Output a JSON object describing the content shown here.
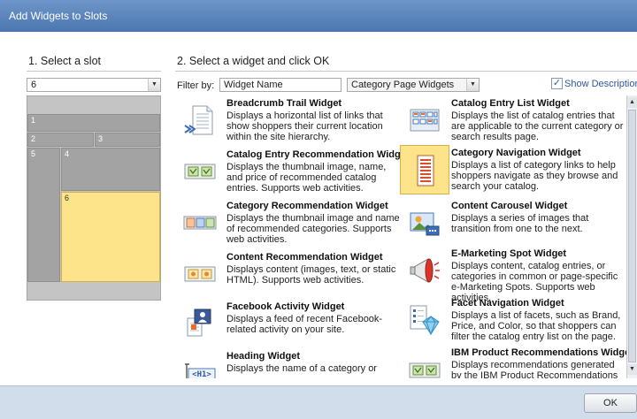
{
  "dialog": {
    "title": "Add Widgets to Slots"
  },
  "slots": {
    "heading": "1. Select a slot",
    "selected": "6",
    "map": [
      "1",
      "2",
      "3",
      "5",
      "4",
      "6"
    ]
  },
  "widget_panel": {
    "heading": "2. Select a widget and click OK",
    "filter_label": "Filter by:",
    "filter_value": "Widget Name",
    "category_value": "Category Page Widgets",
    "show_description_label": "Show Description",
    "show_description_checked": true
  },
  "widgets": [
    {
      "title": "Breadcrumb Trail Widget",
      "desc": "Displays a horizontal list of links that show shoppers their current location within the site hierarchy.",
      "icon": "breadcrumb-icon"
    },
    {
      "title": "Catalog Entry List Widget",
      "desc": "Displays the list of catalog entries that are applicable to the current category or search results page.",
      "icon": "catalog-entry-list-icon"
    },
    {
      "title": "Catalog Entry Recommendation Widget",
      "desc": "Displays the thumbnail image, name, and price of recommended catalog entries. Supports web activities.",
      "icon": "catalog-entry-recommendation-icon"
    },
    {
      "title": "Category Navigation Widget",
      "desc": "Displays a list of category links to help shoppers navigate as they browse and search your catalog.",
      "icon": "category-navigation-icon"
    },
    {
      "title": "Category Recommendation Widget",
      "desc": "Displays the thumbnail image and name of recommended categories. Supports web activities.",
      "icon": "category-recommendation-icon"
    },
    {
      "title": "Content Carousel Widget",
      "desc": "Displays a series of images that transition from one to the next.",
      "icon": "content-carousel-icon"
    },
    {
      "title": "Content Recommendation Widget",
      "desc": "Displays content (images, text, or static HTML). Supports web activities.",
      "icon": "content-recommendation-icon"
    },
    {
      "title": "E-Marketing Spot Widget",
      "desc": "Displays content, catalog entries, or categories in common or page-specific e-Marketing Spots. Supports web activities.",
      "icon": "megaphone-icon"
    },
    {
      "title": "Facebook Activity Widget",
      "desc": "Displays a feed of recent Facebook-related activity on your site.",
      "icon": "facebook-activity-icon"
    },
    {
      "title": "Facet Navigation Widget",
      "desc": "Displays a list of facets, such as Brand, Price, and Color, so that shoppers can filter the catalog entry list on the page.",
      "icon": "facet-navigation-icon"
    },
    {
      "title": "Heading Widget",
      "desc": "Displays the name of a category or",
      "icon": "heading-icon",
      "icon_text": "<H1>"
    },
    {
      "title": "IBM Product Recommendations Widget",
      "desc": "Displays recommendations generated by the IBM Product Recommendations",
      "icon": "ibm-product-recommendations-icon"
    }
  ],
  "footer": {
    "ok_label": "OK"
  },
  "colors": {
    "titlebar": "#5a83bb",
    "selected": "#fde389",
    "slot": "#a3a3a3",
    "footer": "#d2ddec"
  }
}
